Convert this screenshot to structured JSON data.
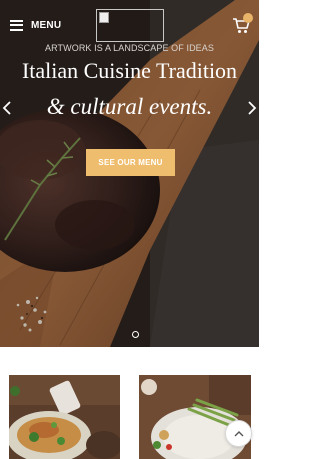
{
  "header": {
    "menu_label": "MENU",
    "menu_icon": "hamburger-icon",
    "logo_icon": "broken-image-icon",
    "cart_icon": "cart-icon"
  },
  "hero": {
    "tagline": "ARTWORK IS A LANDSCAPE OF IDEAS",
    "title": "Italian Cuisine Tradition",
    "subtitle": "& cultural events.",
    "cta_label": "SEE OUR MENU",
    "prev_icon": "chevron-left-icon",
    "next_icon": "chevron-right-icon",
    "slide_indicator_icon": "slide-dot-icon"
  },
  "back_to_top_icon": "chevron-up-icon",
  "colors": {
    "accent": "#efbd6e",
    "badge": "#e8b46a",
    "hero_dark": "#241d18"
  }
}
